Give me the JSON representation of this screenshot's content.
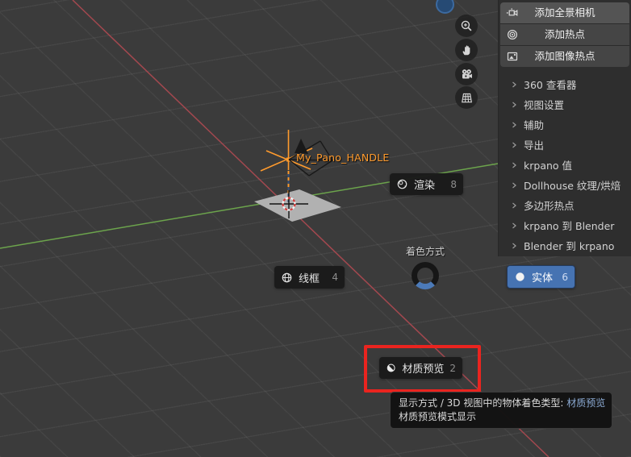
{
  "viewport": {
    "object_label": "My_Pano_HANDLE",
    "colors": {
      "background": "#3b3b3b",
      "axis_x": "#a3484f",
      "axis_y": "#6ca44c",
      "selection_orange": "#ff9b2d",
      "accent_blue": "#4673b2"
    }
  },
  "nav_toolbar": {
    "items": [
      {
        "icon": "zoom-icon"
      },
      {
        "icon": "pan-hand-icon"
      },
      {
        "icon": "camera-view-icon"
      },
      {
        "icon": "ortho-grid-icon"
      }
    ]
  },
  "pie_menu": {
    "title": "着色方式",
    "items": [
      {
        "label": "渲染",
        "shortcut": "8",
        "icon": "rendered-shading-icon",
        "selected": false
      },
      {
        "label": "线框",
        "shortcut": "4",
        "icon": "wireframe-shading-icon",
        "selected": false
      },
      {
        "label": "实体",
        "shortcut": "6",
        "icon": "solid-shading-icon",
        "selected": true
      },
      {
        "label": "材质预览",
        "shortcut": "2",
        "icon": "material-preview-shading-icon",
        "selected": false
      }
    ],
    "selected_color": "#4673b2"
  },
  "sidebar": {
    "buttons": [
      {
        "label": "添加全景相机",
        "icon": "panorama-camera-icon"
      },
      {
        "label": "添加热点",
        "icon": "hotspot-icon"
      },
      {
        "label": "添加图像热点",
        "icon": "image-hotspot-icon"
      }
    ],
    "sections": [
      {
        "label": "360 查看器"
      },
      {
        "label": "视图设置"
      },
      {
        "label": "辅助"
      },
      {
        "label": "导出"
      },
      {
        "label": "krpano 值"
      },
      {
        "label": "Dollhouse 纹理/烘焙"
      },
      {
        "label": "多边形热点"
      },
      {
        "label": "krpano 到 Blender"
      },
      {
        "label": "Blender 到 krpano"
      }
    ]
  },
  "tooltip": {
    "line1_prefix": "显示方式 / 3D 视图中的物体着色类型: ",
    "line1_value": "材质预览",
    "line2": "材质预览模式显示",
    "value_color": "#8cabd4"
  },
  "annotation": {
    "highlight_color": "#ea241f"
  }
}
